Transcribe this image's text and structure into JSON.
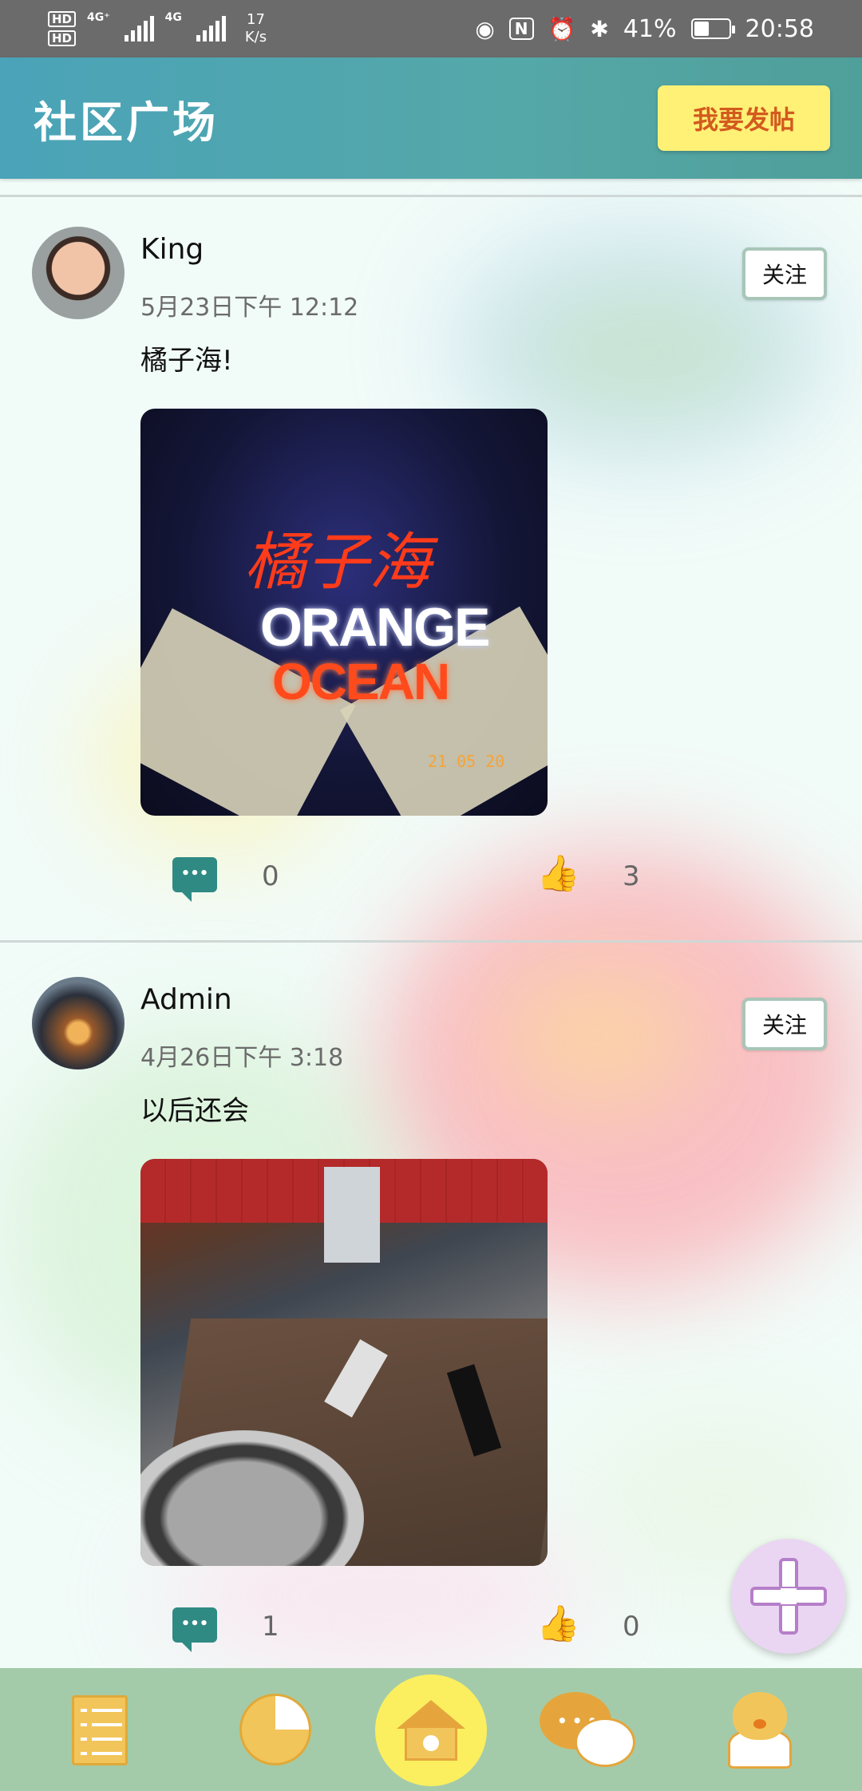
{
  "status_bar": {
    "hd1": "HD",
    "hd2": "HD",
    "net1": "4G⁺",
    "net2": "4G",
    "speed_value": "17",
    "speed_unit": "K/s",
    "battery": "41%",
    "time": "20:58",
    "icons": [
      "eye-icon",
      "nfc-icon",
      "alarm-icon",
      "bluetooth-icon",
      "battery-icon"
    ]
  },
  "header": {
    "title": "社区广场",
    "post_button": "我要发帖"
  },
  "posts": [
    {
      "username": "King",
      "time": "5月23日下午 12:12",
      "text": "橘子海!",
      "follow_label": "关注",
      "photo_text_1": "ORANGE",
      "photo_text_2": "OCEAN",
      "photo_script": "橘子海",
      "photo_date": "21 05 20",
      "comments": "0",
      "likes": "3"
    },
    {
      "username": "Admin",
      "time": "4月26日下午 3:18",
      "text": "以后还会",
      "follow_label": "关注",
      "comments": "1",
      "likes": "0"
    }
  ],
  "colors": {
    "header_gradient_start": "#4aa3b8",
    "header_gradient_end": "#4f9f9a",
    "post_button_bg": "#fff176",
    "post_button_text": "#d35a1e",
    "bottom_nav_bg": "#a4cba9",
    "comment_icon": "#2f8a84",
    "like_active": "#f0a020",
    "like_inactive": "#2f7c86",
    "fab_bg": "#ead6f2"
  },
  "bottom_nav": {
    "items": [
      "list-icon",
      "pie-chart-icon",
      "home-icon",
      "chat-icon",
      "profile-icon"
    ],
    "active": "home-icon"
  },
  "fab": {
    "icon": "plus-icon"
  }
}
